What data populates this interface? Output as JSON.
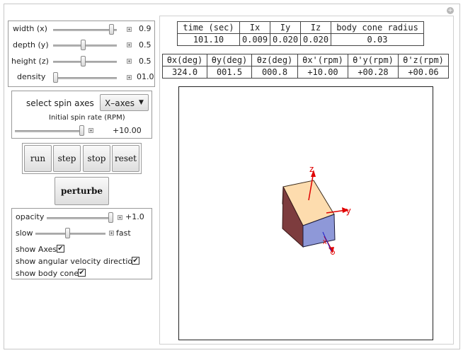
{
  "sliders": {
    "width": {
      "label": "width (x)",
      "value": "0.9",
      "fraction": 0.9
    },
    "depth": {
      "label": "depth (y)",
      "value": "0.5",
      "fraction": 0.45
    },
    "height": {
      "label": "height (z)",
      "value": "0.5",
      "fraction": 0.45
    },
    "density": {
      "label": "density",
      "value": "01.0",
      "fraction": 0.0
    }
  },
  "spin": {
    "select_label": "select spin axes",
    "select_value": "X–axes",
    "rate_label": "Initial spin rate (RPM)",
    "rate_value": "+10.00",
    "rate_fraction": 1.0
  },
  "buttons": {
    "run": "run",
    "step": "step",
    "stop": "stop",
    "reset": "reset",
    "perturbe": "perturbe"
  },
  "options": {
    "opacity_label": "opacity",
    "opacity_value": "+1.0",
    "opacity_fraction": 1.0,
    "speed_left": "slow",
    "speed_right": "fast",
    "speed_fraction": 0.45,
    "show_axes": "show Axes",
    "show_angular": "show angular velocity direction",
    "show_cone": "show body cone",
    "check_mark": "✔"
  },
  "table1": {
    "headers": [
      "time (sec)",
      "Ix",
      "Iy",
      "Iz",
      "body cone radius"
    ],
    "values": [
      "101.10",
      "0.009",
      "0.020",
      "0.020",
      "0.03"
    ]
  },
  "table2": {
    "headers": [
      "θx(deg)",
      "θy(deg)",
      "θz(deg)",
      "θx'(rpm)",
      "θ'y(rpm)",
      "θ'z(rpm)"
    ],
    "values": [
      "324.0",
      "001.5",
      "000.8",
      "+10.00",
      "+00.28",
      "+00.06"
    ]
  },
  "axes": {
    "x": "x",
    "y": "y",
    "z": "z"
  },
  "colors": {
    "axis": "#e00000",
    "angular": "#2222cc",
    "face_top": "#fddcae",
    "face_right": "#8e98d8",
    "face_left": "#7d3c3e"
  }
}
